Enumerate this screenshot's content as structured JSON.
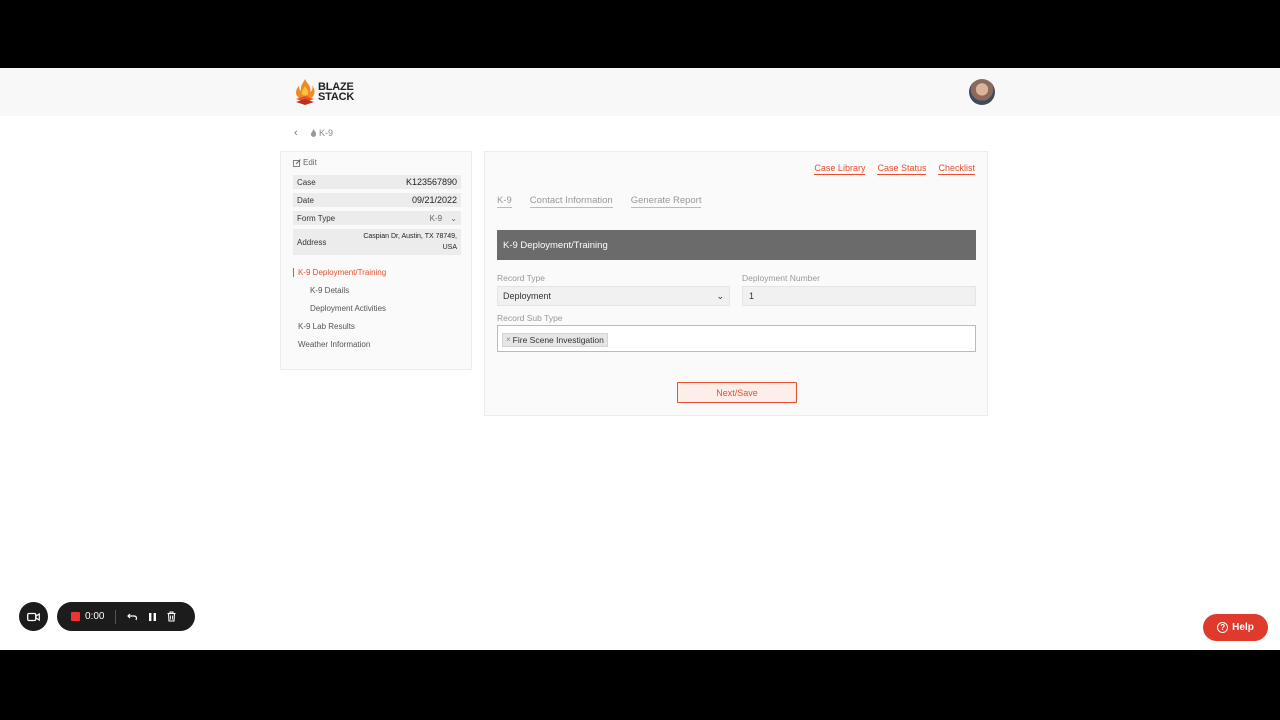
{
  "app": {
    "logo_line1": "BLAZE",
    "logo_line2": "STACK"
  },
  "breadcrumb": {
    "current": "K-9"
  },
  "sidebar": {
    "edit_label": "Edit",
    "info": [
      {
        "label": "Case",
        "value": "K123567890"
      },
      {
        "label": "Date",
        "value": "09/21/2022"
      },
      {
        "label": "Form Type",
        "value": "K-9"
      },
      {
        "label": "Address",
        "value_line1": "Caspian Dr, Austin, TX 78749,",
        "value_line2": "USA"
      }
    ],
    "nav": [
      {
        "label": "K-9 Deployment/Training",
        "active": true
      },
      {
        "label": "K-9 Details"
      },
      {
        "label": "Deployment Activities"
      },
      {
        "label": "K-9 Lab Results"
      },
      {
        "label": "Weather Information"
      }
    ]
  },
  "main": {
    "top_links": [
      "Case Library",
      "Case Status",
      "Checklist"
    ],
    "tabs": [
      "K-9",
      "Contact Information",
      "Generate Report"
    ],
    "section_title": "K-9 Deployment/Training",
    "record_type": {
      "label": "Record Type",
      "value": "Deployment"
    },
    "deployment_number": {
      "label": "Deployment Number",
      "value": "1"
    },
    "record_sub_type": {
      "label": "Record Sub Type",
      "tags": [
        "Fire Scene Investigation"
      ]
    },
    "next_button": "Next/Save"
  },
  "recorder": {
    "time": "0:00"
  },
  "help": {
    "label": "Help"
  },
  "colors": {
    "accent": "#e84e2f",
    "section_header": "#6b6b6b",
    "help": "#e03a2c"
  }
}
